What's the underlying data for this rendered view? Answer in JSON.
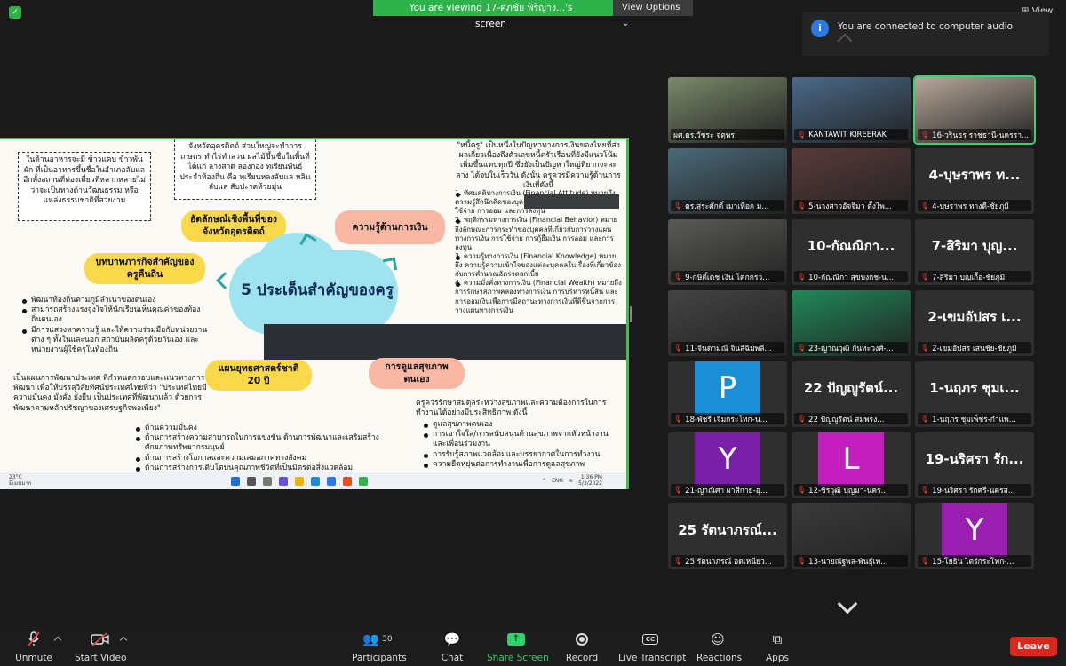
{
  "banner": {
    "viewing_text": "You are viewing 17-ศุภชัย พิริญาง...'s screen",
    "view_options": "View Options",
    "view_label": "View"
  },
  "toast": {
    "message": "You are connected to computer audio"
  },
  "slide": {
    "box1": "ในด้านอาหารจะมี ข้าวแคบ ข้าวพัน ผัก ที่เป็นอาหารขึ้นชื่อในอำเภอลับแล อีกทั้งสถานที่ท่องเที่ยวที่หลากหลายไม่ว่าจะเป็นทางด้านวัฒนธรรม หรือแหล่งธรรมชาติที่สวยงาม",
    "box2": "จังหวัดอุตรดิตถ์ ส่วนใหญ่จะทำการเกษตร ทำไร่ทำสวน ผลไม้ขึ้นชื่อในพื้นที่ ได้แก่ ลางสาด ลองกอง ทุเรียนพันธุ์ประจำท้องถิ่น คือ ทุเรียนหลงลับแล หลินลับแล สับปะรดห้วยมุ่น",
    "pill_identity": "อัตลักษณ์เชิงพื้นที่ของจังหวัดอุตรดิตถ์",
    "pill_finance": "ความรู้ด้านการเงิน",
    "pill_role": "บทบาทภารกิจสำคัญของครูคืนถิ่น",
    "pill_strategy": "แผนยุทธศาสตร์ชาติ 20 ปี",
    "pill_health": "การดูแลสุขภาพตนเอง",
    "center_title": "5 ประเด็นสำคัญของครู",
    "finance_intro": "\"หนี้ครู\" เป็นหนึ่งในปัญหาทางการเงินของไทยที่ส่งผลเกี่ยวเนื่องถึงตัวเลขหนี้ครัวเรือนที่ยังมีแนวโน้มเพิ่มขึ้นแทบทุกปี ซึ่งยังเป็นปัญหาใหญ่ที่ยากจะละลาง ได้จบในเร็ววัน ดังนั้น ครูควรมีความรู้ด้านการเงินที่ดังนี้",
    "finance_items": [
      "1. ทัศนคติทางการเงิน (Financial Attitude) หมายถึง ความรู้สึกนึกคิดของบุคคลที่มีต่อเรื่องที่เกี่ยวข้องกับการใช้จ่าย การออม และการลงทุน",
      "2. พฤติกรรมทางการเงิน (Financial Behavior) หมายถึงลักษณะการกระทำของบุคคลที่เกี่ยวกับการวางแผนทางการเงิน การใช้จ่าย การกู้ยืมเงิน การออม และการลงทุน",
      "3. ความรู้ทางการเงิน (Financial Knowledge) หมายถึง ความรู้ความเข้าใจของแต่ละบุคคลในเรื่องที่เกี่ยวข้องกับการคำนวณอัตราดอกเบี้ย",
      "4. ความมั่งคั่งทางการเงิน (Financial Wealth) หมายถึง การรักษาสภาพคล่องทางการเงิน การบริหารหนี้สิน และการออมเงินเพื่อการมีสถานะทางการเงินที่ดีขึ้นจากการวางแผนทางการเงิน"
    ],
    "role_items": [
      "พัฒนาท้องถิ่นตามภูมิลำเนาของตนเอง",
      "สามารถสร้างแรงจูงใจให้นักเรียนเห็นคุณค่าของท้องถิ่นตนเอง",
      "มีการแสวงหาความรู้ และให้ความร่วมมือกับหน่วยงานต่าง ๆ ทั้งในและนอก สถาบันผลิตครูด้วยกันเอง และหน่วยงานผู้ใช้ครูในท้องถิ่น"
    ],
    "strategy_para": "เป็นแผนการพัฒนาประเทศ ที่กำหนดกรอบและแนวทางการพัฒนา เพื่อให้บรรลุวิสัยทัศน์ประเทศไทยที่ว่า \"ประเทศไทยมีความมั่นคง มั่งคั่ง ยั่งยืน เป็นประเทศที่พัฒนาแล้ว ด้วยการพัฒนาตามหลักปรัชญาของเศรษฐกิจพอเพียง\"",
    "strategy_items": [
      "ด้านความมั่นคง",
      "ด้านการสร้างความสามารถในการแข่งขัน ด้านการพัฒนาและเสริมสร้างศักยภาพทรัพยากรมนุษย์",
      "ด้านการสร้างโอกาสและความเสมอภาคทางสังคม",
      "ด้านการสร้างการเติบโตบนคุณภาพชีวิตที่เป็นมิตรต่อสิ่งแวดล้อม"
    ],
    "health_para": "ครูควรรักษาสมดุลระหว่างสุขภาพและความต้องการในการทำงานได้อย่างมีประสิทธิภาพ ดังนี้",
    "health_items": [
      "ดูแลสุขภาพตนเอง",
      "การเอาใจใส่/การสนับสนุนด้านสุขภาพจากหัวหน้างานและเพื่อนร่วมงาน",
      "การรับรู้สภาพแวดล้อมและบรรยากาศในการทำงาน",
      "ความยืดหยุ่นต่อการทำงานเพื่อการดูแลสุขภาพ"
    ],
    "taskbar": {
      "weather_temp": "23°C",
      "weather_desc": "มีเมฆมาก",
      "lang": "ENG",
      "time": "1:36 PM",
      "date": "5/3/2022"
    }
  },
  "participants": [
    {
      "name": "ผศ.ดร.วัชระ จตุพร",
      "big": "",
      "video": "#7a8a6a",
      "active": false,
      "mic": false
    },
    {
      "name": "KANTAWIT KIREERAK",
      "big": "",
      "video": "#4a6a8a",
      "active": false,
      "mic": true
    },
    {
      "name": "16-วรินธร ราชธานี-นครรา...",
      "big": "",
      "video": "#b8a89a",
      "active": true,
      "mic": true
    },
    {
      "name": "ดร.สุระศักดิ์ เมาเทือก ม...",
      "big": "",
      "video": "#4a6a7a",
      "active": false,
      "mic": true
    },
    {
      "name": "5-นางสาวอัจจิมา ตั้งไพ...",
      "big": "",
      "video": "#5a3a3a",
      "active": false,
      "mic": true
    },
    {
      "name": "4-บุษราพร ทางดี-ชัยภูมิ",
      "big": "4-บุษราพร ท...",
      "video": "",
      "active": false,
      "mic": true
    },
    {
      "name": "9-กษิดิ์เดช เงิน โคกกรว...",
      "big": "",
      "video": "#5a5a55",
      "active": false,
      "mic": true
    },
    {
      "name": "10-กัณณิกา สุขบงกช-น...",
      "big": "10-กัณณิกา...",
      "video": "",
      "active": false,
      "mic": true
    },
    {
      "name": "7-สิริมา บุญเกื้อ-ชัยภูมิ",
      "big": "7-สิริมา บุญ...",
      "video": "",
      "active": false,
      "mic": true
    },
    {
      "name": "11-จินดามณี จินสีฉิมพลี...",
      "big": "",
      "video": "#444",
      "active": false,
      "mic": true
    },
    {
      "name": "23-ญาณวุฒิ กันทะวงศ์-...",
      "big": "",
      "video": "#1f8a5a",
      "active": false,
      "mic": true
    },
    {
      "name": "2-เขมอัปสร เสนชัย-ชัยภูมิ",
      "big": "2-เขมอัปสร เ...",
      "video": "",
      "active": false,
      "mic": true
    },
    {
      "name": "18-พัชรี เจิมกระโทก-น...",
      "big": "P",
      "video": "#1a8fd8",
      "active": false,
      "mic": true
    },
    {
      "name": "22 ปัญญูรัตน์ สมพรง...",
      "big": "22 ปัญญูรัตน์...",
      "video": "",
      "active": false,
      "mic": true
    },
    {
      "name": "1-นฤภร ชุมเพ็ชร-กำแพ...",
      "big": "1-นฤภร ชุมเ...",
      "video": "",
      "active": false,
      "mic": true
    },
    {
      "name": "21-ญาณิศา ผาสีกาย-อุ...",
      "big": "Y",
      "video": "#7a1fa8",
      "active": false,
      "mic": true
    },
    {
      "name": "12-ชิรวุฒิ บุญมา-นคร...",
      "big": "L",
      "video": "#c21fbe",
      "active": false,
      "mic": true
    },
    {
      "name": "19-นริศรา รักศรี-นครส...",
      "big": "19-นริศรา รัก...",
      "video": "",
      "active": false,
      "mic": true
    },
    {
      "name": "25 รัตนาภรณ์ อดเหนียว...",
      "big": "25 รัตนาภรณ์...",
      "video": "",
      "active": false,
      "mic": true
    },
    {
      "name": "13-นายณัฐพล-พันธุ์เพ...",
      "big": "",
      "video": "#3a3a3a",
      "active": false,
      "mic": true
    },
    {
      "name": "15-โยธิน ไตร่กระโทก-...",
      "big": "Y",
      "video": "#9a1fb0",
      "active": false,
      "mic": true
    }
  ],
  "toolbar": {
    "unmute": "Unmute",
    "start_video": "Start Video",
    "participants": "Participants",
    "participants_count": "30",
    "chat": "Chat",
    "share_screen": "Share Screen",
    "record": "Record",
    "live_transcript": "Live Transcript",
    "reactions": "Reactions",
    "apps": "Apps",
    "leave": "Leave",
    "cc_text": "CC"
  }
}
